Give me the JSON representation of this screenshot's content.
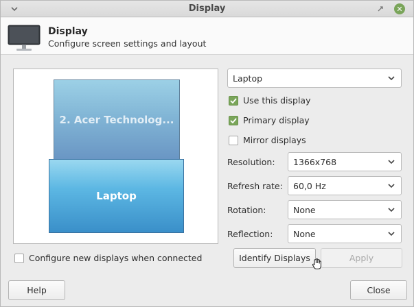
{
  "window": {
    "title": "Display",
    "menu_icon": "chevron-down-icon",
    "minimize_icon": "minimize-icon",
    "close_icon": "close-icon"
  },
  "header": {
    "icon": "monitor-icon",
    "title": "Display",
    "subtitle": "Configure screen settings and layout"
  },
  "preview": {
    "screens": [
      {
        "label": "2. Acer Technolog..."
      },
      {
        "label": "Laptop"
      }
    ]
  },
  "settings": {
    "monitor_select": "Laptop",
    "use_display": {
      "label": "Use this display",
      "checked": true
    },
    "primary_display": {
      "label": "Primary display",
      "checked": true
    },
    "mirror_displays": {
      "label": "Mirror displays",
      "checked": false
    },
    "resolution": {
      "label": "Resolution:",
      "value": "1366x768"
    },
    "refresh_rate": {
      "label": "Refresh rate:",
      "value": "60,0 Hz"
    },
    "rotation": {
      "label": "Rotation:",
      "value": "None"
    },
    "reflection": {
      "label": "Reflection:",
      "value": "None"
    }
  },
  "configure_new": {
    "label": "Configure new displays when connected",
    "checked": false
  },
  "buttons": {
    "identify": "Identify Displays",
    "apply": "Apply",
    "help": "Help",
    "close": "Close"
  },
  "colors": {
    "accent": "#7aa55a",
    "screen_blue": "#3a8fc9"
  }
}
